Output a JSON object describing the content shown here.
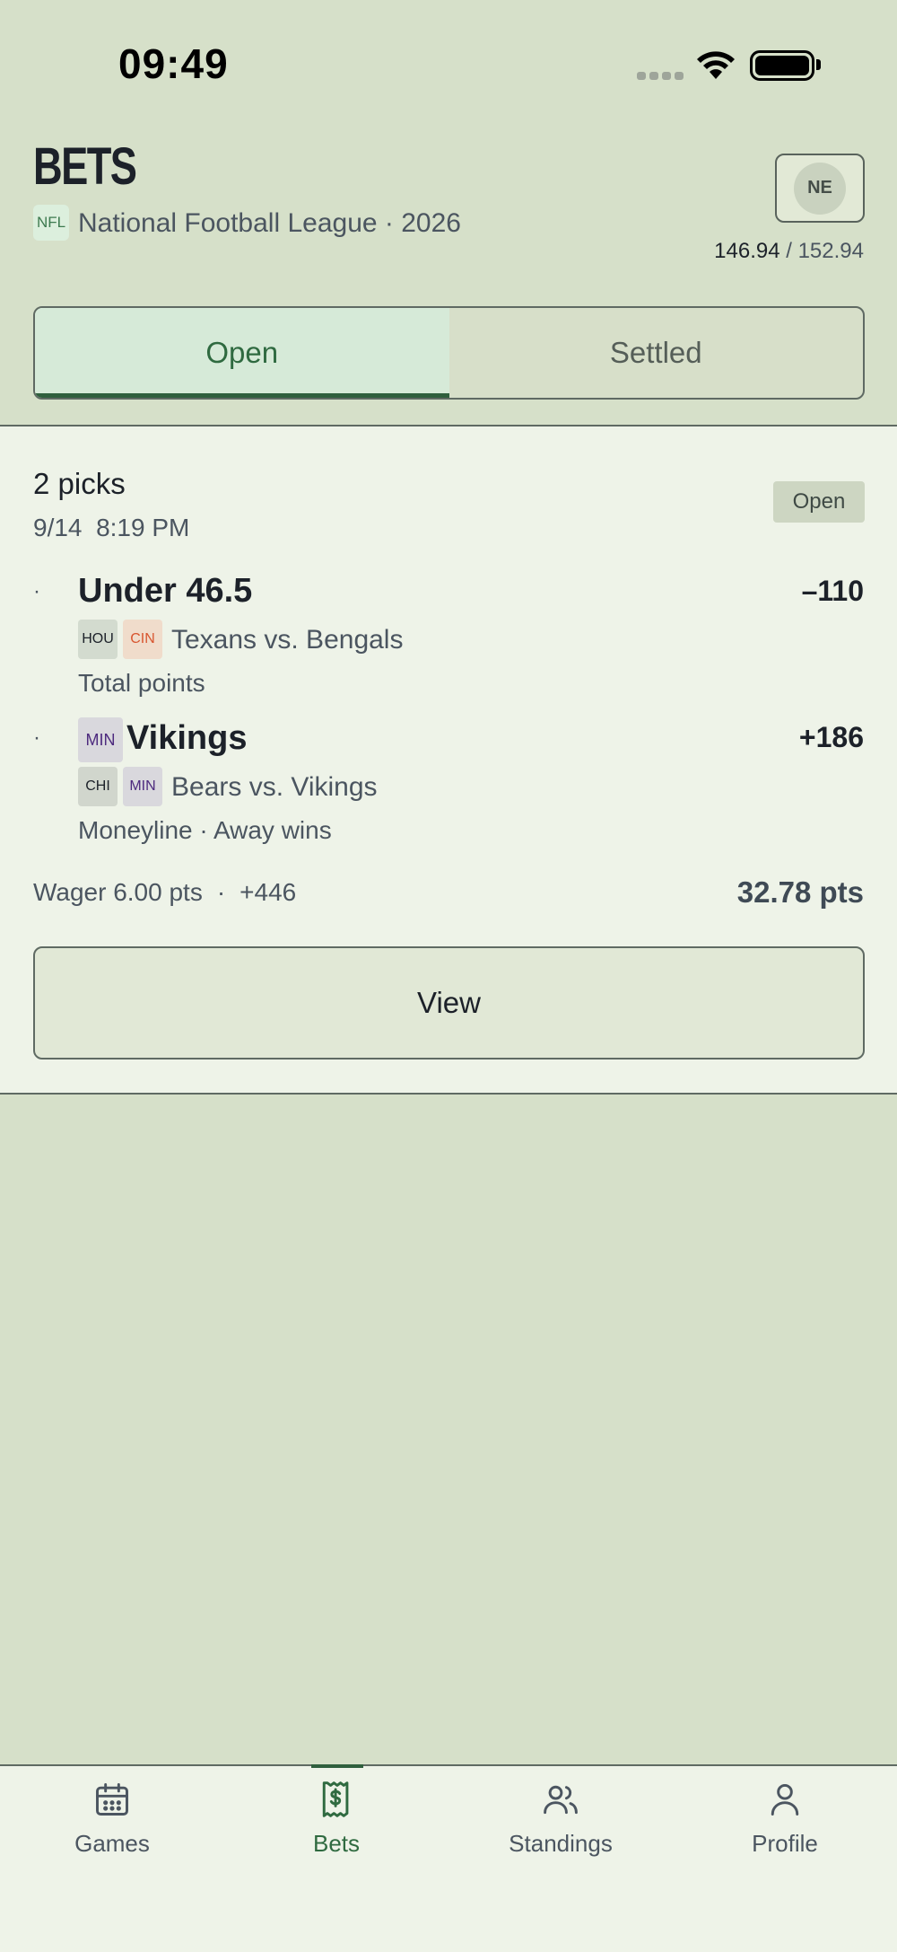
{
  "status_bar": {
    "time": "09:49"
  },
  "header": {
    "title": "BETS",
    "league_badge": "NFL",
    "league_name": "National Football League · 2026",
    "team_abbr": "NE",
    "points_current": "146.94",
    "points_total": "/ 152.94"
  },
  "tabs": {
    "open": "Open",
    "settled": "Settled",
    "active": "open"
  },
  "bet": {
    "picks_count": "2 picks",
    "date": "9/14",
    "time": "8:19 PM",
    "status": "Open",
    "legs": [
      {
        "bullet": "·",
        "title": "Under 46.5",
        "odds": "–110",
        "chips": [
          "HOU",
          "CIN"
        ],
        "matchup": "Texans vs. Bengals",
        "market": "Total points"
      },
      {
        "bullet": "·",
        "title_chip": "MIN",
        "title": "Vikings",
        "odds": "+186",
        "chips": [
          "CHI",
          "MIN"
        ],
        "matchup": "Bears vs. Vikings",
        "market": "Moneyline · Away wins"
      }
    ],
    "wager": "Wager 6.00 pts",
    "dot": "·",
    "combined_odds": "+446",
    "payout": "32.78 pts",
    "view_label": "View"
  },
  "tabbar": {
    "items": [
      {
        "label": "Games",
        "icon": "calendar-icon"
      },
      {
        "label": "Bets",
        "icon": "receipt-dollar-icon"
      },
      {
        "label": "Standings",
        "icon": "users-icon"
      },
      {
        "label": "Profile",
        "icon": "user-icon"
      }
    ],
    "active": "Bets"
  },
  "colors": {
    "background": "#d6e0c9",
    "card": "#eef3e8",
    "accent": "#2f6a40",
    "text": "#1c2129",
    "muted": "#4b5560"
  }
}
